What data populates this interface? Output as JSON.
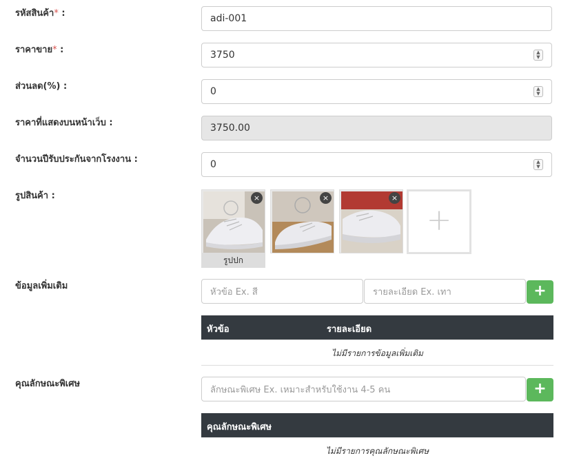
{
  "form": {
    "sku": {
      "label": "รหัสสินค้า",
      "required_mark": "*",
      "colon": " :",
      "value": "adi-001"
    },
    "price": {
      "label": "ราคาขาย",
      "required_mark": "*",
      "colon": " :",
      "value": "3750"
    },
    "discount": {
      "label": "ส่วนลด(%) :",
      "value": "0"
    },
    "web_price": {
      "label": "ราคาที่แสดงบนหน้าเว็บ :",
      "value": "3750.00"
    },
    "warranty": {
      "label": "จำนวนปีรับประกันจากโรงงาน :",
      "value": "0"
    },
    "photos": {
      "label": "รูปสินค้า :",
      "cover_caption": "รูปปก",
      "delete_glyph": "×",
      "add_glyph": "+"
    },
    "extra_info": {
      "label": "ข้อมูลเพิ่มเติม",
      "topic_placeholder": "หัวข้อ Ex. สี",
      "detail_placeholder": "รายละเอียด Ex. เทา",
      "add_glyph": "+",
      "columns": [
        "หัวข้อ",
        "รายละเอียด"
      ],
      "empty_text": "ไม่มีรายการข้อมูลเพิ่มเติม"
    },
    "features": {
      "label": "คุณลักษณะพิเศษ",
      "placeholder": "ลักษณะพิเศษ Ex. เหมาะสำหรับใช้งาน 4-5 คน",
      "add_glyph": "+",
      "column": "คุณลักษณะพิเศษ",
      "empty_text": "ไม่มีรายการคุณลักษณะพิเศษ"
    }
  },
  "colors": {
    "required": "#d9534f",
    "add_button": "#5cb85c",
    "table_header": "#343a40"
  }
}
